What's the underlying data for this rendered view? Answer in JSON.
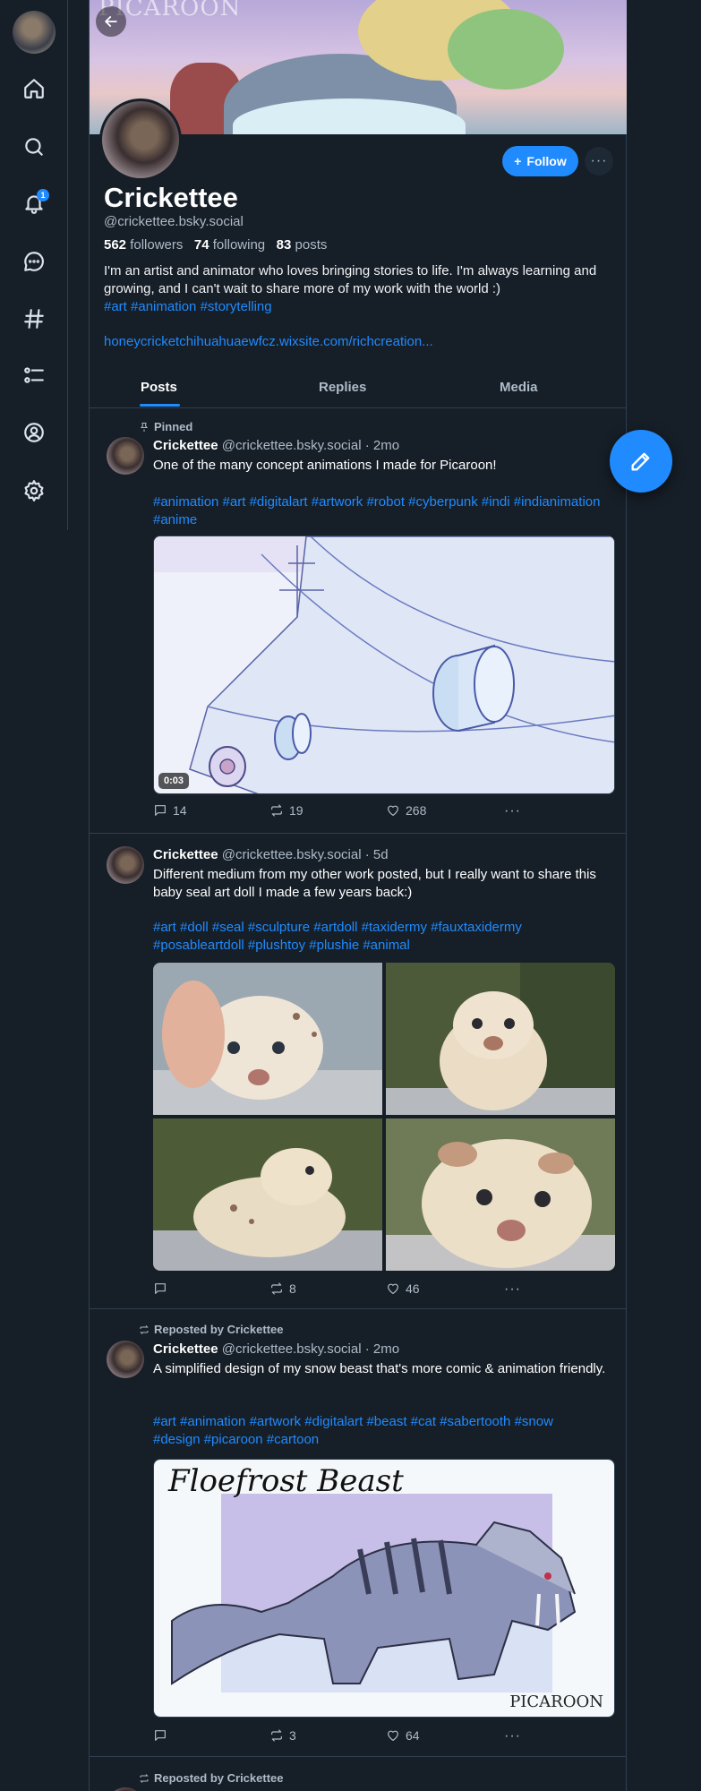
{
  "profile": {
    "name": "Crickettee",
    "handle": "@crickettee.bsky.social",
    "followers_count": "562",
    "followers_label": "followers",
    "following_count": "74",
    "following_label": "following",
    "posts_count": "83",
    "posts_label": "posts",
    "bio": "I'm an artist and animator who loves bringing stories to life. I'm always learning and growing, and I can't wait to share more of my work with the world :)",
    "bio_tags": "#art #animation #storytelling",
    "link": "honeycricketchihuahuaewfcz.wixsite.com/richcreation...",
    "follow_label": "Follow",
    "banner_logo": "PICAROON",
    "notifications_badge": "1"
  },
  "tabs": [
    {
      "label": "Posts"
    },
    {
      "label": "Replies"
    },
    {
      "label": "Media"
    }
  ],
  "posts": [
    {
      "meta": "Pinned",
      "author": "Crickettee",
      "handle_time": "@crickettee.bsky.social · 2mo",
      "text": "One of the many concept animations I made for Picaroon!",
      "tags": "#animation #art #digitalart #artwork #robot #cyberpunk #indi #indianimation #anime",
      "video_duration": "0:03",
      "replies": "14",
      "reposts": "19",
      "likes": "268"
    },
    {
      "meta": "",
      "author": "Crickettee",
      "handle_time": "@crickettee.bsky.social · 5d",
      "text": "Different medium from my other work posted, but I really want to share this baby seal art doll I made a few years back:)",
      "tags": "#art #doll #seal #sculpture #artdoll #taxidermy #fauxtaxidermy #posableartdoll #plushtoy #plushie #animal",
      "replies": "",
      "reposts": "8",
      "likes": "46"
    },
    {
      "meta": "Reposted by Crickettee",
      "author": "Crickettee",
      "handle_time": "@crickettee.bsky.social · 2mo",
      "text": "A simplified design of my snow beast that's more comic & animation friendly.",
      "tags": "#art #animation #artwork #digitalart #beast #cat #sabertooth #snow #design #picaroon #cartoon",
      "image_title": "Floefrost Beast",
      "image_signature": "PICAROON",
      "replies": "",
      "reposts": "3",
      "likes": "64"
    },
    {
      "meta": "Reposted by Crickettee"
    }
  ],
  "colors": {
    "background": "#161e27",
    "accent": "#208bfe",
    "muted": "#aebbc9",
    "border": "#2e4052"
  }
}
